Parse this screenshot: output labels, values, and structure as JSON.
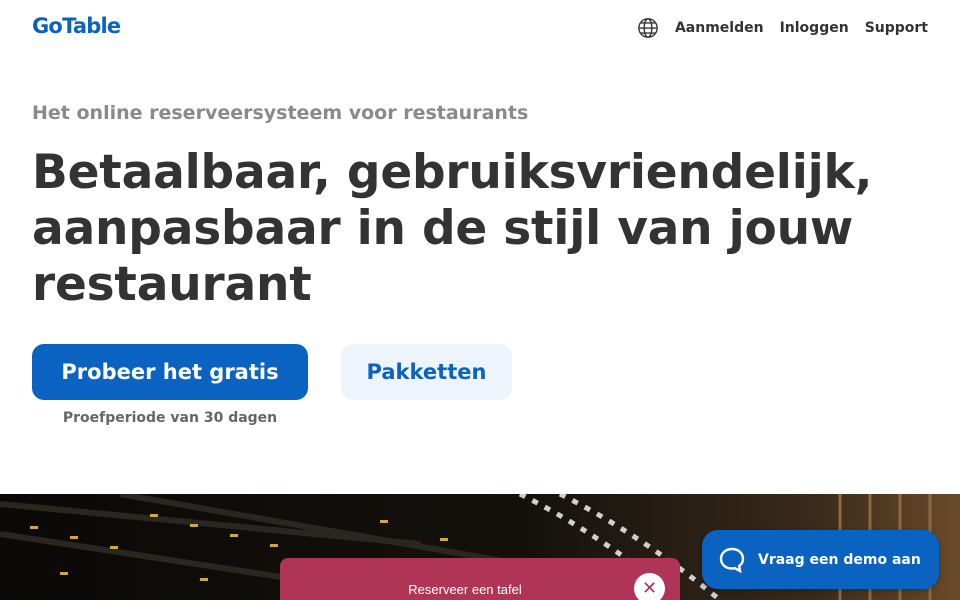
{
  "brand": {
    "logo": "GoTable",
    "accent": "#0a63c0"
  },
  "nav": {
    "language_icon": "globe-icon",
    "links": [
      "Aanmelden",
      "Inloggen",
      "Support"
    ]
  },
  "hero": {
    "eyebrow": "Het online reserveersysteem voor restaurants",
    "headline": "Betaalbaar, gebruiksvriendelijk, aanpasbaar in de stijl van jouw restaurant",
    "primary_button": "Probeer het gratis",
    "secondary_button": "Pakketten",
    "trial_note": "Proefperiode van 30 dagen"
  },
  "booking_widget": {
    "title": "Reserveer een tafel",
    "close_icon": "close-icon",
    "color": "#b03458"
  },
  "demo_button": {
    "label": "Vraag een demo aan",
    "icon": "chat-bubble-icon"
  }
}
